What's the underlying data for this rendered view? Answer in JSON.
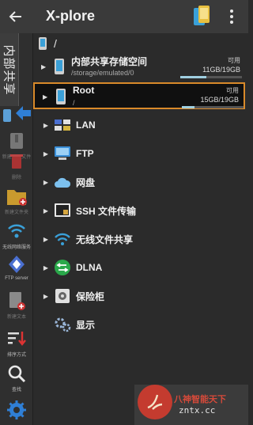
{
  "app": {
    "title": "X-plore"
  },
  "sidebar": {
    "tab_label": "内部共享",
    "items": [
      {
        "label": "新建 ZIP 文件",
        "icon": "zip-icon",
        "dim": true
      },
      {
        "label": "删除",
        "icon": "trash-icon",
        "dim": true
      },
      {
        "label": "新建文件夹",
        "icon": "new-folder-icon",
        "dim": true
      },
      {
        "label": "无线网络服务",
        "icon": "wifi-server-icon",
        "dim": false
      },
      {
        "label": "FTP server",
        "icon": "ftp-server-icon",
        "dim": false
      },
      {
        "label": "新建文本",
        "icon": "new-text-icon",
        "dim": true
      },
      {
        "label": "排序方式",
        "icon": "sort-icon",
        "dim": false
      },
      {
        "label": "查找",
        "icon": "search-icon",
        "dim": false
      },
      {
        "label": "",
        "icon": "gear-icon",
        "dim": false
      }
    ]
  },
  "content": {
    "path": "/",
    "storages": [
      {
        "name": "内部共享存储空间",
        "sub": "/storage/emulated/0",
        "avail_label": "可用",
        "size": "11GB/19GB",
        "used_fraction": 0.42,
        "selected": false
      },
      {
        "name": "Root",
        "sub": "/",
        "avail_label": "可用",
        "size": "15GB/19GB",
        "used_fraction": 0.21,
        "selected": true
      }
    ],
    "entries": [
      {
        "name": "LAN",
        "icon": "lan-icon",
        "expandable": true
      },
      {
        "name": "FTP",
        "icon": "ftp-icon",
        "expandable": true
      },
      {
        "name": "网盘",
        "icon": "cloud-icon",
        "expandable": true
      },
      {
        "name": "SSH 文件传输",
        "icon": "ssh-icon",
        "expandable": true
      },
      {
        "name": "无线文件共享",
        "icon": "wifi-share-icon",
        "expandable": true
      },
      {
        "name": "DLNA",
        "icon": "dlna-icon",
        "expandable": true
      },
      {
        "name": "保险柜",
        "icon": "vault-icon",
        "expandable": true
      },
      {
        "name": "显示",
        "icon": "display-settings-icon",
        "expandable": false
      }
    ]
  },
  "watermark": {
    "title": "八神智能天下",
    "domain": "zntx.cc"
  },
  "colors": {
    "selection_border": "#d98a2a",
    "accent_blue": "#2f7fd6",
    "bar_fill": "#9fcfe0"
  }
}
